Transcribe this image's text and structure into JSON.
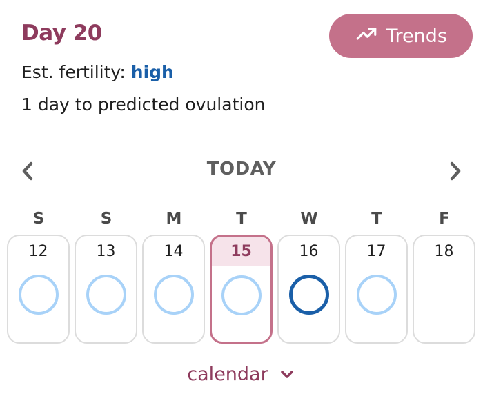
{
  "header": {
    "day_title": "Day 20",
    "fertility_label": "Est. fertility:",
    "fertility_value": "high",
    "ovulation_text": "1 day to predicted ovulation"
  },
  "trends_button": {
    "label": "Trends",
    "icon": "trending-up-icon"
  },
  "week_nav": {
    "label": "TODAY",
    "prev_icon": "chevron-left-icon",
    "next_icon": "chevron-right-icon"
  },
  "weekdays": [
    "S",
    "S",
    "M",
    "T",
    "W",
    "T",
    "F"
  ],
  "days": [
    {
      "num": "12",
      "ring": "light"
    },
    {
      "num": "13",
      "ring": "light"
    },
    {
      "num": "14",
      "ring": "light"
    },
    {
      "num": "15",
      "ring": "light",
      "selected": true
    },
    {
      "num": "16",
      "ring": "high"
    },
    {
      "num": "17",
      "ring": "light"
    },
    {
      "num": "18",
      "ring": "none"
    }
  ],
  "calendar_toggle": {
    "label": "calendar",
    "icon": "chevron-down-icon"
  },
  "colors": {
    "accent": "#8e3b5d",
    "button": "#c4718a",
    "fertility_high": "#1a5fa8",
    "ring_light": "#a8d2f8"
  }
}
